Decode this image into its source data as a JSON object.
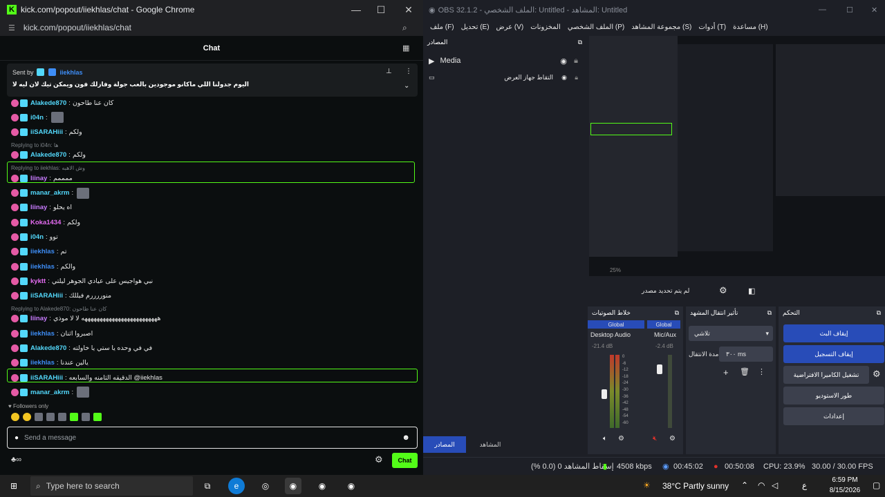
{
  "chrome": {
    "title": "kick.com/popout/iiekhlas/chat - Google Chrome",
    "url": "kick.com/popout/iiekhlas/chat",
    "chat_header": "Chat",
    "pinned": {
      "sent_by": "Sent by",
      "sender": "iiekhlas",
      "text": "اليوم جدولنا اللي ماكانو موجودين بالعب جولة وفازلك فون ويمكن تيك لان ليه لا"
    },
    "messages": [
      {
        "user": "Alakede870",
        "text": "كان عنا طاحون",
        "color": "#53d8fb"
      },
      {
        "user": "i04n",
        "text": "",
        "color": "#53d8fb"
      },
      {
        "user": "iiSARAHiii",
        "text": "ولكم",
        "color": "#53d8fb"
      },
      {
        "reply": "Replying to i04n: ها"
      },
      {
        "user": "Alakede870",
        "text": "ولكم",
        "color": "#53d8fb"
      },
      {
        "reply": "Replying to iiekhlas: وش الاهبه"
      },
      {
        "user": "Iiinay",
        "text": "ممممم",
        "color": "#c97cff"
      },
      {
        "user": "manar_akrm",
        "text": "",
        "color": "#53d8fb"
      },
      {
        "user": "Iiinay",
        "text": "اه يحلو",
        "color": "#c97cff"
      },
      {
        "user": "Koka1434",
        "text": "ولكم",
        "color": "#e56cf2"
      },
      {
        "user": "i04n",
        "text": "توو",
        "color": "#53d8fb"
      },
      {
        "user": "iiekhlas",
        "text": "تم",
        "color": "#3e8ef7"
      },
      {
        "user": "iiekhlas",
        "text": "والكم",
        "color": "#3e8ef7"
      },
      {
        "user": "kyktt",
        "text": "نبي هواجيس على عيادي الجوهر ليلتي",
        "color": "#e56cf2"
      },
      {
        "user": "iiSARAHiii",
        "text": "منوررررم فيللك",
        "color": "#53d8fb"
      },
      {
        "reply": "Replying to Alakede870: كان عنا طاحون"
      },
      {
        "user": "Iiinay",
        "text": "هههههههههههههههههههههههههه لا لا موذي",
        "color": "#c97cff"
      },
      {
        "user": "iiekhlas",
        "text": "اصبروا اثنان",
        "color": "#3e8ef7"
      },
      {
        "user": "Alakede870",
        "text": "في في وحده يا ستي يا خاولته",
        "color": "#53d8fb"
      },
      {
        "user": "iiekhlas",
        "text": "يالين عندنا",
        "color": "#3e8ef7"
      },
      {
        "user": "iiSARAHiii",
        "text": "الدقيقه الثامنه والسابعه @iiekhlas",
        "color": "#53d8fb"
      },
      {
        "user": "manar_akrm",
        "text": "",
        "color": "#53d8fb"
      }
    ],
    "followers_only": "Followers only",
    "input_placeholder": "Send a message",
    "send_label": "Chat"
  },
  "obs": {
    "title": "OBS 32.1.2 - الملف الشخصي: Untitled - المشاهد: Untitled",
    "menu": [
      "ملف (F)",
      "تحديل (E)",
      "عرض (V)",
      "المخزونات",
      "الملف الشخصي (P)",
      "مجموعة المشاهد (S)",
      "أدوات (T)",
      "مساعدة (H)"
    ],
    "sources_title": "المصادر",
    "sources": [
      {
        "name": "Media"
      },
      {
        "name": "التقاط جهاز العرض"
      }
    ],
    "preview_zoom": "25%",
    "no_source": "لم يتم تحديد مصدر",
    "mixer_title": "خلاط الصوتيات",
    "mixer_tracks": [
      {
        "scope": "Global",
        "name": "Desktop Audio",
        "db": "-21.4 dB"
      },
      {
        "scope": "Global",
        "name": "Mic/Aux",
        "db": "-2.4 dB"
      }
    ],
    "meter_ticks": [
      "0",
      "-6",
      "-12",
      "-18",
      "-24",
      "-30",
      "-36",
      "-42",
      "-48",
      "-54",
      "-60"
    ],
    "transition_title": "تأثير انتقال المشهد",
    "transition_value": "تلاشي",
    "transition_duration_label": "مدة الانتقال",
    "transition_duration": "٣٠٠ ms",
    "controls_title": "التحكم",
    "controls": [
      {
        "label": "إيقاف البث",
        "active": true
      },
      {
        "label": "إيقاف التسجيل",
        "active": true
      },
      {
        "label": "تشغيل الكاميرا الافتراضية",
        "active": false
      },
      {
        "label": "طور الاستوديو",
        "active": false
      },
      {
        "label": "إعدادات",
        "active": false
      }
    ],
    "bottom_tabs": [
      "المصادر",
      "المشاهد"
    ],
    "status": {
      "dropped": "إسقاط المشاهد 0 (0.0 %)",
      "bitrate": "4508 kbps",
      "stream_time": "00:45:02",
      "rec_time": "00:50:08",
      "cpu": "CPU: 23.9%",
      "fps": "30.00 / 30.00 FPS"
    }
  },
  "taskbar": {
    "search_placeholder": "Type here to search",
    "weather": "38°C  Partly sunny",
    "lang": "ع",
    "time": "6:59 PM",
    "date": "8/15/2026"
  },
  "colors": {
    "kick_green": "#53fc18",
    "obs_blue": "#284cb8",
    "rec_red": "#e0312b"
  }
}
